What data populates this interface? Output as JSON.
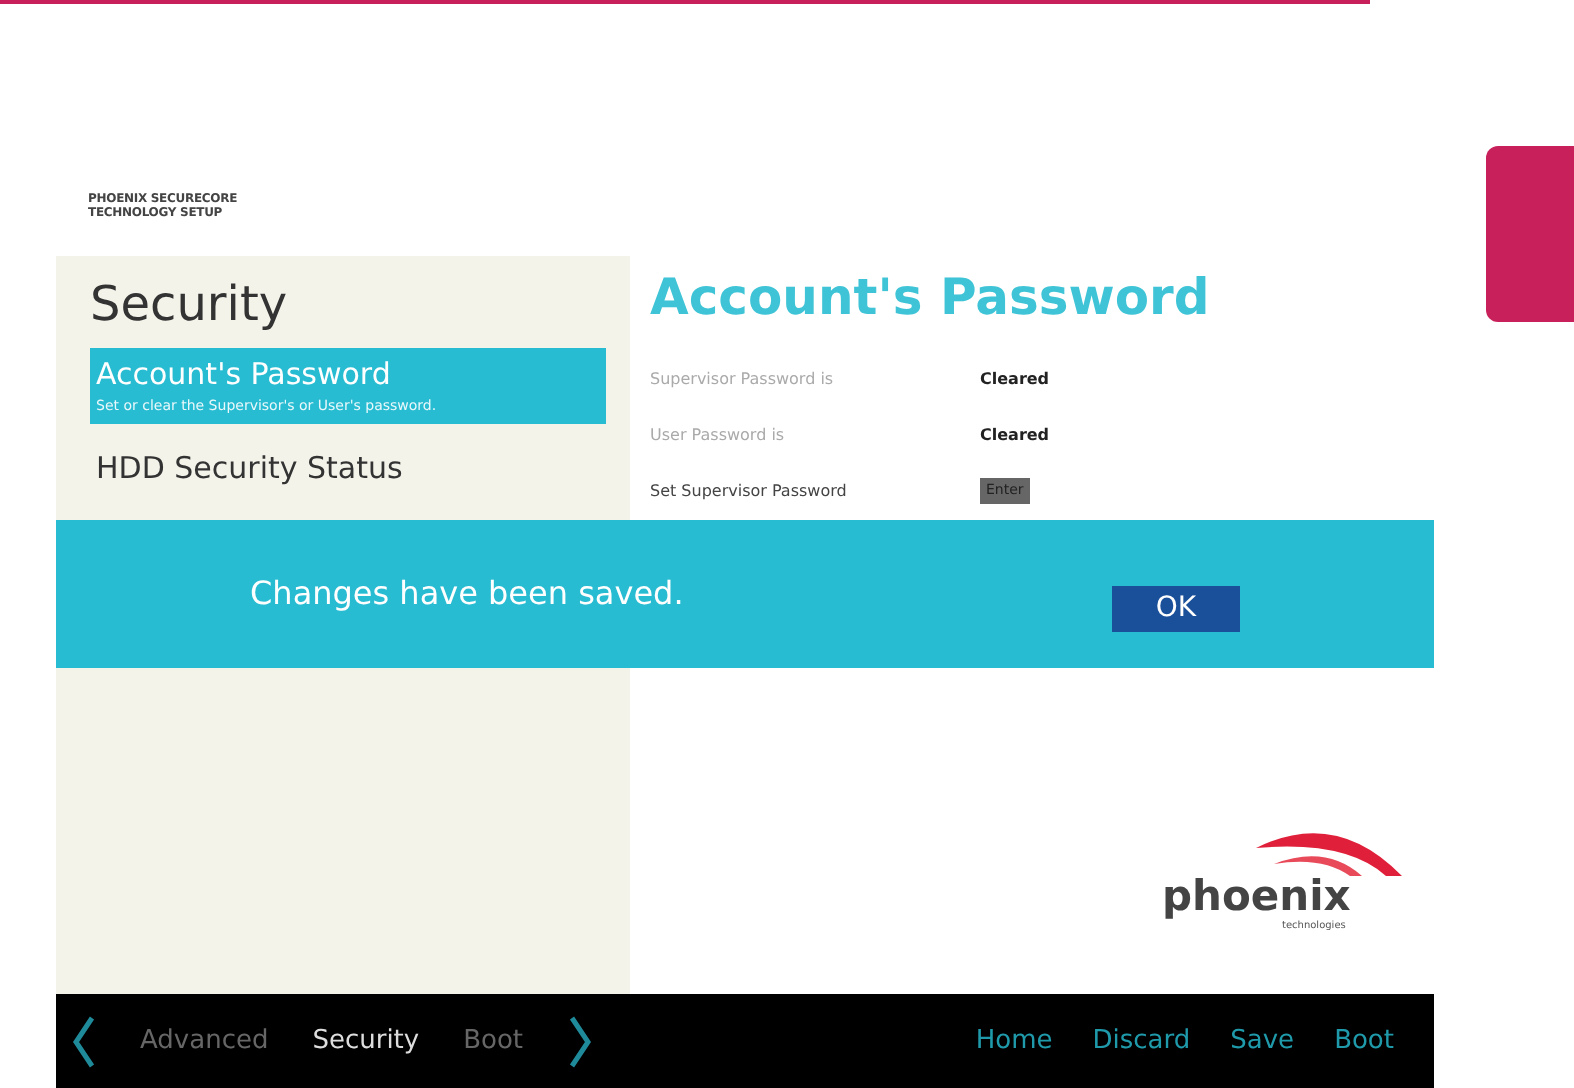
{
  "header": {
    "lines": [
      "PHOENIX SECURECORE",
      "TECHNOLOGY SETUP"
    ]
  },
  "sidebar": {
    "title": "Security",
    "items": [
      {
        "label": "Account's Password",
        "description": "Set or clear the Supervisor's or User's password.",
        "selected": true
      },
      {
        "label": "HDD Security Status",
        "selected": false
      }
    ]
  },
  "panel": {
    "title": "Account's Password",
    "rows": [
      {
        "kind": "value",
        "label": "Supervisor Password is",
        "value": "Cleared"
      },
      {
        "kind": "value",
        "label": "User Password is",
        "value": "Cleared"
      },
      {
        "kind": "button",
        "label": "Set Supervisor Password",
        "value": "Enter"
      }
    ]
  },
  "logo": {
    "name": "phoenix",
    "tagline": "technologies"
  },
  "dialog": {
    "message": "Changes have been saved.",
    "button": "OK"
  },
  "bottom_bar": {
    "tabs": [
      {
        "label": "Advanced",
        "selected": false
      },
      {
        "label": "Security",
        "selected": true
      },
      {
        "label": "Boot",
        "selected": false
      }
    ],
    "actions": [
      "Home",
      "Discard",
      "Save",
      "Boot"
    ]
  }
}
